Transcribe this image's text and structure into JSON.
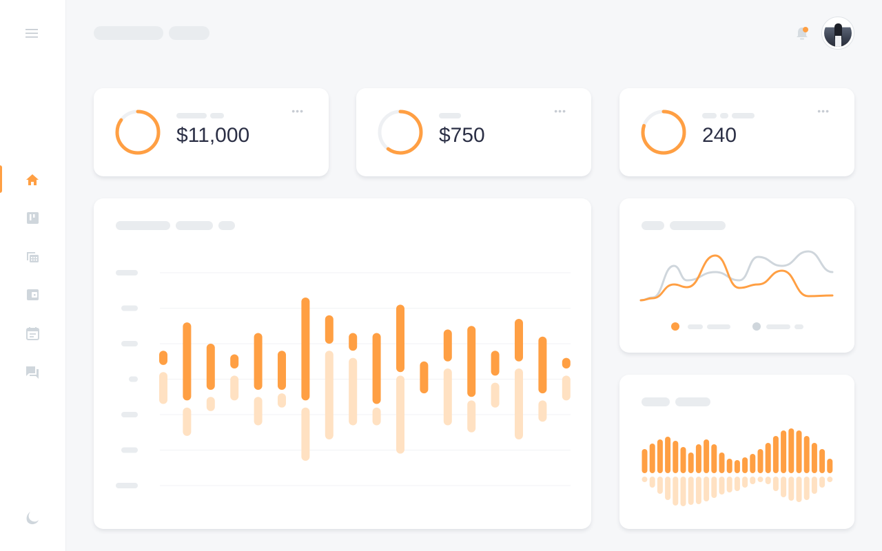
{
  "colors": {
    "accent": "#ff9f43",
    "accent_light": "#ffe1c2",
    "muted": "#cfd6dc",
    "text": "#2b2f45",
    "placeholder": "#e9ecef"
  },
  "sidebar": {
    "menu_icon": "hamburger-icon",
    "items": [
      {
        "icon": "home-icon",
        "active": true
      },
      {
        "icon": "board-icon",
        "active": false
      },
      {
        "icon": "spreadsheet-icon",
        "active": false
      },
      {
        "icon": "wallet-icon",
        "active": false
      },
      {
        "icon": "calendar-icon",
        "active": false
      },
      {
        "icon": "chat-icon",
        "active": false
      }
    ],
    "footer_icon": "theme-icon"
  },
  "header": {
    "notification_icon": "bell-icon",
    "has_notification": true,
    "avatar": "user-avatar"
  },
  "stats": [
    {
      "value": "$11,000",
      "progress": 0.85
    },
    {
      "value": "$750",
      "progress": 0.6
    },
    {
      "value": "240",
      "progress": 0.8
    }
  ],
  "chart_data": [
    {
      "type": "bar",
      "grid": true,
      "ylim": [
        0,
        6
      ],
      "series": [
        {
          "ranges": [
            [
              3.4,
              3.8
            ],
            [
              2.4,
              4.6
            ],
            [
              2.7,
              4.0
            ],
            [
              3.3,
              3.7
            ],
            [
              2.7,
              4.3
            ],
            [
              2.7,
              3.8
            ],
            [
              2.4,
              5.3
            ],
            [
              4.0,
              4.8
            ],
            [
              3.8,
              4.3
            ],
            [
              2.3,
              4.3
            ],
            [
              3.2,
              5.1
            ],
            [
              2.6,
              3.5
            ],
            [
              3.5,
              4.4
            ],
            [
              2.5,
              4.5
            ],
            [
              3.1,
              3.8
            ],
            [
              3.5,
              4.7
            ],
            [
              2.6,
              4.2
            ],
            [
              3.3,
              3.6
            ]
          ]
        },
        {
          "ranges": [
            [
              2.3,
              3.2
            ],
            [
              1.4,
              2.2
            ],
            [
              2.1,
              2.5
            ],
            [
              2.4,
              3.1
            ],
            [
              1.7,
              2.5
            ],
            [
              2.2,
              2.6
            ],
            [
              0.7,
              2.2
            ],
            [
              1.3,
              3.8
            ],
            [
              1.7,
              3.6
            ],
            [
              1.7,
              2.2
            ],
            [
              0.9,
              3.1
            ],
            null,
            [
              1.7,
              3.3
            ],
            [
              1.5,
              2.4
            ],
            [
              2.2,
              2.9
            ],
            [
              1.3,
              3.3
            ],
            [
              1.8,
              2.4
            ],
            [
              2.4,
              3.1
            ]
          ]
        }
      ]
    },
    {
      "type": "line",
      "legend": "bottom",
      "series": [
        {
          "color": "#ff9f43",
          "values": [
            4,
            7,
            27,
            23,
            69,
            22,
            27,
            47,
            10,
            11
          ]
        },
        {
          "color": "#cfd6dc",
          "values": [
            4,
            8,
            54,
            33,
            45,
            33,
            67,
            54,
            75,
            45
          ]
        }
      ]
    },
    {
      "type": "bar",
      "series": [
        {
          "values": [
            35,
            43,
            49,
            53,
            47,
            38,
            30,
            42,
            49,
            42,
            30,
            21,
            19,
            23,
            28,
            35,
            44,
            54,
            62,
            65,
            62,
            54,
            44,
            35,
            21
          ]
        },
        {
          "values": [
            -8,
            -16,
            -25,
            -34,
            -42,
            -43,
            -41,
            -40,
            -36,
            -31,
            -26,
            -23,
            -21,
            -16,
            -11,
            -7,
            -11,
            -21,
            -30,
            -35,
            -37,
            -34,
            -25,
            -16,
            -7
          ]
        }
      ]
    }
  ]
}
